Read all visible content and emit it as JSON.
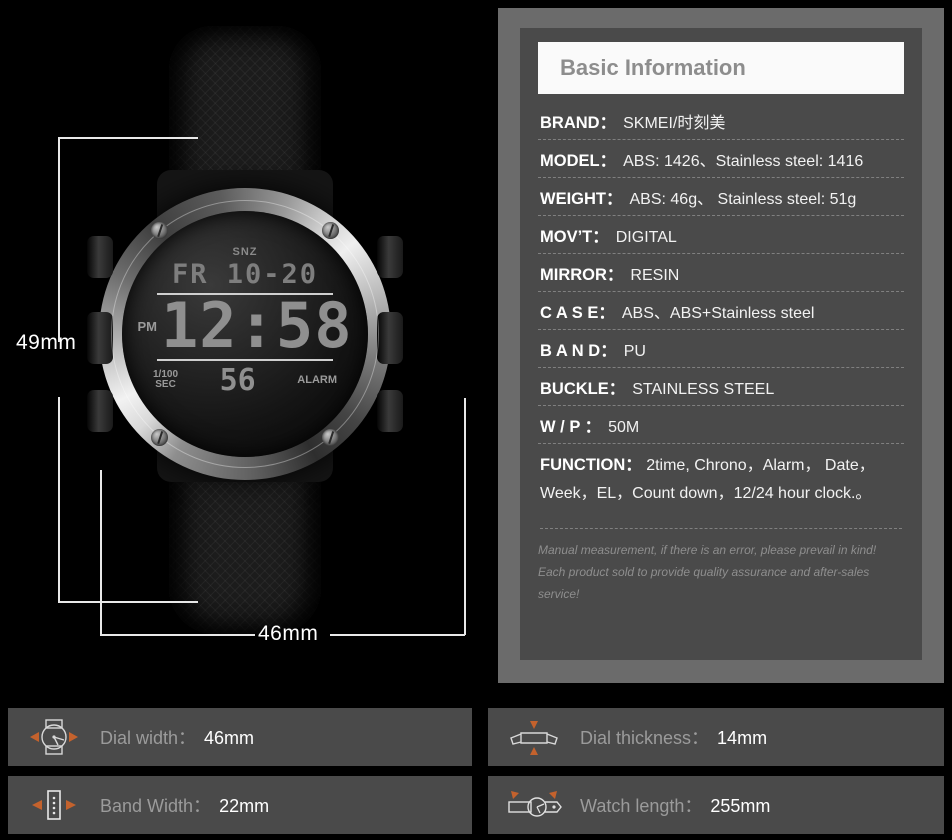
{
  "product_photo": {
    "alt": "SKMEI digital sport watch front view",
    "lcd": {
      "snz": "SNZ",
      "date": "FR 10-20",
      "meridiem": "PM",
      "time": "12:58",
      "sub_label_line1": "1/100",
      "sub_label_line2": "SEC",
      "seconds": "56",
      "alarm": "ALARM"
    },
    "dimensions": {
      "height_label": "49mm",
      "width_label": "46mm"
    }
  },
  "info": {
    "title": "Basic Information",
    "specs": [
      {
        "label": "BRAND：",
        "value": "SKMEI/时刻美"
      },
      {
        "label": "MODEL：",
        "value": "ABS: 1426、Stainless steel: 1416"
      },
      {
        "label": "WEIGHT：",
        "value": "ABS: 46g、 Stainless steel: 51g"
      },
      {
        "label": "MOV’T：",
        "value": "DIGITAL"
      },
      {
        "label": "MIRROR：",
        "value": "RESIN"
      },
      {
        "label": "C A S E：",
        "value": "ABS、ABS+Stainless steel"
      },
      {
        "label": "B A N D：",
        "value": "PU"
      },
      {
        "label": "BUCKLE：",
        "value": "STAINLESS STEEL"
      },
      {
        "label": "W / P ：",
        "value": "50M"
      }
    ],
    "function": {
      "label": "FUNCTION：",
      "value": "2time, Chrono，Alarm， Date，Week，EL，Count down，12/24 hour clock.。"
    },
    "notes": [
      "Manual measurement, if there is an error, please prevail in kind!",
      "Each product sold to provide quality assurance and after-sales service!"
    ]
  },
  "measurement_bars": [
    {
      "icon": "dial-width-icon",
      "label": "Dial width：",
      "value": "46mm"
    },
    {
      "icon": "band-width-icon",
      "label": "Band Width：",
      "value": "22mm"
    },
    {
      "icon": "dial-thickness-icon",
      "label": "Dial thickness：",
      "value": "14mm"
    },
    {
      "icon": "watch-length-icon",
      "label": "Watch length：",
      "value": "255mm"
    }
  ],
  "colors": {
    "background": "#000000",
    "panel_outer": "#6b6b6b",
    "panel_inner": "#4a4a4a",
    "title_bar": "#fafafa",
    "title_text": "#8d8d8d",
    "accent_orange": "#c4622d",
    "value_white": "#ffffff",
    "label_gray": "#9b9b9b"
  }
}
